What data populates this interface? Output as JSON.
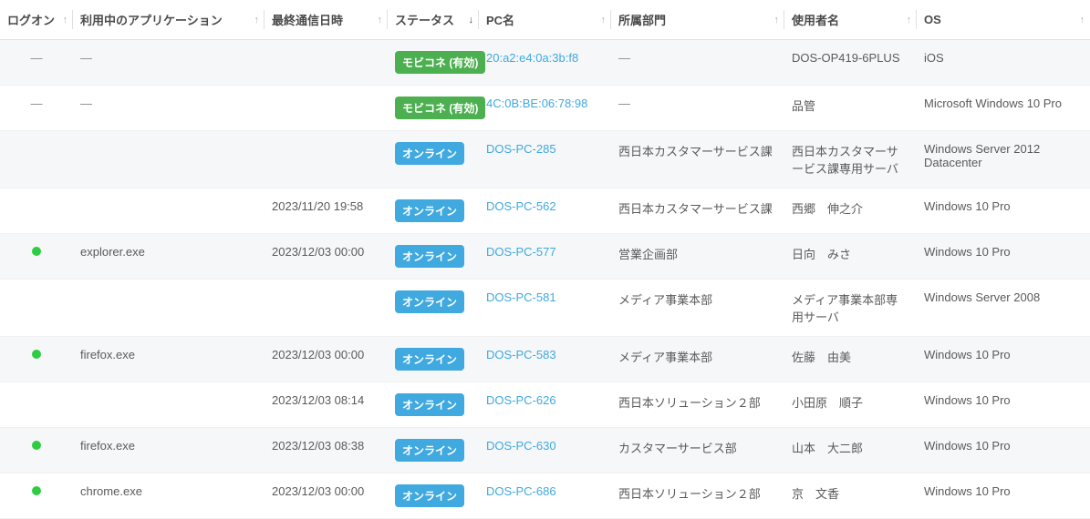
{
  "columns": {
    "logon": {
      "label": "ログオン",
      "arrow": "↑",
      "sorted": false
    },
    "app": {
      "label": "利用中のアプリケーション",
      "arrow": "↑",
      "sorted": false
    },
    "last": {
      "label": "最終通信日時",
      "arrow": "↑",
      "sorted": false
    },
    "status": {
      "label": "ステータス",
      "arrow": "↓",
      "sorted": true
    },
    "pc": {
      "label": "PC名",
      "arrow": "↑",
      "sorted": false
    },
    "dept": {
      "label": "所属部門",
      "arrow": "↑",
      "sorted": false
    },
    "user": {
      "label": "使用者名",
      "arrow": "↑",
      "sorted": false
    },
    "os": {
      "label": "OS",
      "arrow": "↑",
      "sorted": false
    }
  },
  "status_labels": {
    "mobicone": "モビコネ (有効)",
    "online": "オンライン"
  },
  "dash": "—",
  "rows": [
    {
      "alt": true,
      "logon": "dash",
      "app": "dash",
      "last": "",
      "status": "mobicone",
      "pc": "20:a2:e4:0a:3b:f8",
      "dept": "dash",
      "user": "DOS-OP419-6PLUS",
      "os": "iOS"
    },
    {
      "alt": false,
      "logon": "dash",
      "app": "dash",
      "last": "",
      "status": "mobicone",
      "pc": "4C:0B:BE:06:78:98",
      "dept": "dash",
      "user": "品管",
      "os": "Microsoft Windows 10 Pro"
    },
    {
      "alt": true,
      "logon": "",
      "app": "",
      "last": "",
      "status": "online",
      "pc": "DOS-PC-285",
      "dept": "西日本カスタマーサービス課",
      "user": "西日本カスタマーサービス課専用サーバ",
      "os": "Windows Server 2012 Datacenter"
    },
    {
      "alt": false,
      "logon": "",
      "app": "",
      "last": "2023/11/20 19:58",
      "status": "online",
      "pc": "DOS-PC-562",
      "dept": "西日本カスタマーサービス課",
      "user": "西郷　伸之介",
      "os": "Windows 10 Pro"
    },
    {
      "alt": true,
      "logon": "dot",
      "app": "explorer.exe",
      "last": "2023/12/03 00:00",
      "status": "online",
      "pc": "DOS-PC-577",
      "dept": "営業企画部",
      "user": "日向　みさ",
      "os": "Windows 10 Pro"
    },
    {
      "alt": false,
      "logon": "",
      "app": "",
      "last": "",
      "status": "online",
      "pc": "DOS-PC-581",
      "dept": "メディア事業本部",
      "user": "メディア事業本部専用サーバ",
      "os": "Windows Server 2008"
    },
    {
      "alt": true,
      "logon": "dot",
      "app": "firefox.exe",
      "last": "2023/12/03 00:00",
      "status": "online",
      "pc": "DOS-PC-583",
      "dept": "メディア事業本部",
      "user": "佐藤　由美",
      "os": "Windows 10 Pro"
    },
    {
      "alt": false,
      "logon": "",
      "app": "",
      "last": "2023/12/03 08:14",
      "status": "online",
      "pc": "DOS-PC-626",
      "dept": "西日本ソリューション２部",
      "user": "小田原　順子",
      "os": "Windows 10 Pro"
    },
    {
      "alt": true,
      "logon": "dot",
      "app": "firefox.exe",
      "last": "2023/12/03 08:38",
      "status": "online",
      "pc": "DOS-PC-630",
      "dept": "カスタマーサービス部",
      "user": "山本　大二郎",
      "os": "Windows 10 Pro"
    },
    {
      "alt": false,
      "logon": "dot",
      "app": "chrome.exe",
      "last": "2023/12/03 00:00",
      "status": "online",
      "pc": "DOS-PC-686",
      "dept": "西日本ソリューション２部",
      "user": "京　文香",
      "os": "Windows 10 Pro"
    }
  ]
}
